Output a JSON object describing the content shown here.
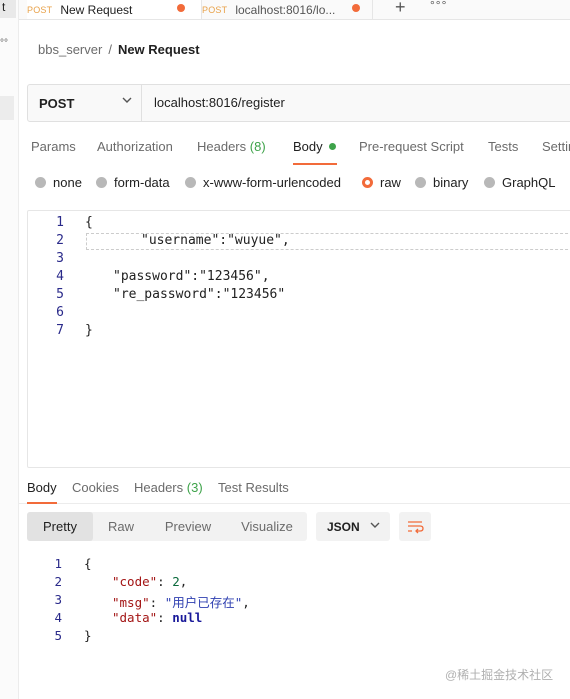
{
  "sidebar": {
    "cut_letter": "t",
    "more": "°°"
  },
  "tabs": [
    {
      "method": "POST",
      "title": "New Request"
    },
    {
      "method": "POST",
      "title": "localhost:8016/lo..."
    }
  ],
  "tabbar": {
    "plus": "+",
    "more": "°°°"
  },
  "breadcrumb": {
    "collection": "bbs_server",
    "separator": "/",
    "request": "New Request"
  },
  "request": {
    "method": "POST",
    "url": "localhost:8016/register",
    "tabs": {
      "params": "Params",
      "authorization": "Authorization",
      "headers": "Headers",
      "headers_count": "(8)",
      "body": "Body",
      "prerequest": "Pre-request Script",
      "tests": "Tests",
      "settings": "Settin"
    },
    "body_modes": [
      "none",
      "form-data",
      "x-www-form-urlencoded",
      "raw",
      "binary",
      "GraphQL"
    ],
    "body_mode_selected": "raw",
    "body_lines": [
      {
        "n": "1",
        "text": "{"
      },
      {
        "n": "2",
        "text": "\"username\":\"wuyue\","
      },
      {
        "n": "3",
        "text": ""
      },
      {
        "n": "4",
        "text": "\"password\":\"123456\","
      },
      {
        "n": "5",
        "text": "\"re_password\":\"123456\""
      },
      {
        "n": "6",
        "text": ""
      },
      {
        "n": "7",
        "text": "}"
      }
    ]
  },
  "response": {
    "tabs": {
      "body": "Body",
      "cookies": "Cookies",
      "headers": "Headers",
      "headers_count": "(3)",
      "test_results": "Test Results"
    },
    "views": [
      "Pretty",
      "Raw",
      "Preview",
      "Visualize"
    ],
    "view_selected": "Pretty",
    "format": "JSON",
    "gutter": [
      "1",
      "2",
      "3",
      "4",
      "5"
    ],
    "json": {
      "open": "{",
      "code_key": "\"code\"",
      "code_value": "2",
      "msg_key": "\"msg\"",
      "msg_value": "\"用户已存在\"",
      "data_key": "\"data\"",
      "data_value": "null",
      "close": "}"
    }
  },
  "watermark": "@稀土掘金技术社区",
  "colors": {
    "accent": "#f26b3a",
    "green": "#3ea34a",
    "method_post": "#e8a24a"
  }
}
